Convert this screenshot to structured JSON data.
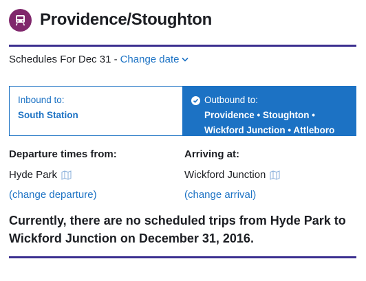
{
  "header": {
    "route_name": "Providence/Stoughton",
    "icon": "commuter-rail-icon",
    "accent": "#80276c"
  },
  "schedule": {
    "prefix": "Schedules For Dec 31 -",
    "change_date_label": "Change date"
  },
  "direction": {
    "inbound": {
      "label": "Inbound to:",
      "destination": "South Station",
      "selected": false
    },
    "outbound": {
      "label": "Outbound to:",
      "destination_line1": "Providence • Stoughton •",
      "destination_line2": "Wickford Junction • Attleboro",
      "selected": true
    }
  },
  "departure": {
    "label": "Departure times from:",
    "stop": "Hyde Park",
    "change_label": "(change departure)"
  },
  "arrival": {
    "label": "Arriving at:",
    "stop": "Wickford Junction",
    "change_label": "(change arrival)"
  },
  "message": "Currently, there are no scheduled trips from Hyde Park to Wickford Junction on December 31, 2016.",
  "colors": {
    "link": "#1c72c4",
    "rule": "#3b2f8f",
    "selected_bg": "#1c72c4"
  }
}
